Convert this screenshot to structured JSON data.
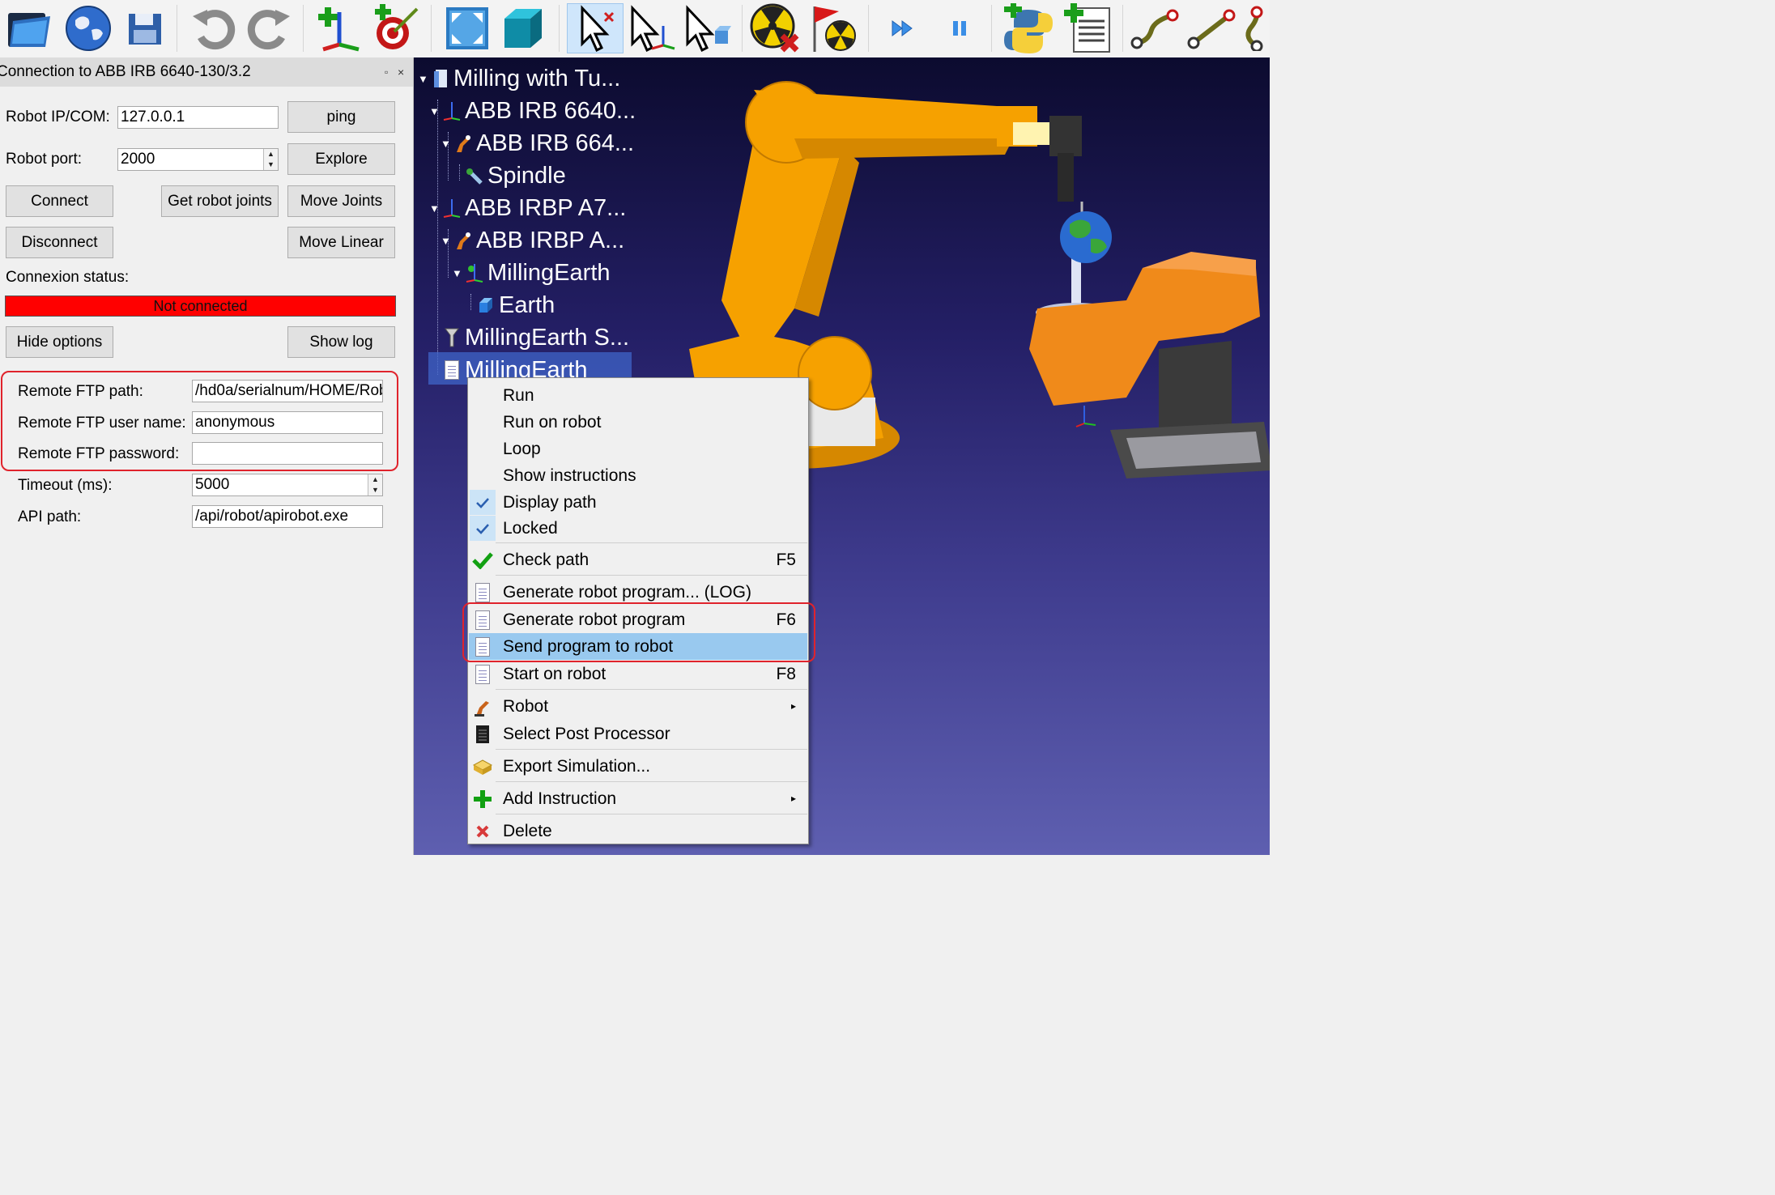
{
  "toolbar": {
    "buttons": [
      "open-icon",
      "globe-icon",
      "save-icon",
      "undo-icon",
      "redo-icon",
      "add-reference-frame-icon",
      "add-target-icon",
      "fit-all-icon",
      "box-view-icon",
      "select-icon",
      "move-reference-icon",
      "move-object-icon",
      "radiation-stop-icon",
      "radiation-flag-icon",
      "fast-forward-icon",
      "pause-icon",
      "python-icon",
      "add-program-icon",
      "path-icon-1",
      "path-icon-2",
      "path-icon-3"
    ]
  },
  "panel": {
    "title": "Connection to ABB IRB 6640-130/3.2",
    "float_btn": "▫",
    "close_btn": "×",
    "robot_ip_label": "Robot IP/COM:",
    "robot_ip_value": "127.0.0.1",
    "ping_label": "ping",
    "robot_port_label": "Robot port:",
    "robot_port_value": "2000",
    "explore_label": "Explore",
    "connect_label": "Connect",
    "get_joints_label": "Get robot joints",
    "move_joints_label": "Move Joints",
    "disconnect_label": "Disconnect",
    "move_linear_label": "Move Linear",
    "status_label": "Connexion status:",
    "status_value": "Not connected",
    "hide_options_label": "Hide options",
    "show_log_label": "Show log",
    "ftp_path_label": "Remote FTP path:",
    "ftp_path_value": "/hd0a/serialnum/HOME/Rob",
    "ftp_user_label": "Remote FTP user name:",
    "ftp_user_value": "anonymous",
    "ftp_password_label": "Remote FTP password:",
    "ftp_password_value": "",
    "timeout_label": "Timeout (ms):",
    "timeout_value": "5000",
    "api_path_label": "API path:",
    "api_path_value": "/api/robot/apirobot.exe"
  },
  "tree": {
    "items": [
      {
        "label": "Milling with Tu..."
      },
      {
        "label": "ABB IRB 6640..."
      },
      {
        "label": "ABB IRB 664..."
      },
      {
        "label": "Spindle"
      },
      {
        "label": "ABB IRBP A7..."
      },
      {
        "label": "ABB IRBP A..."
      },
      {
        "label": "MillingEarth"
      },
      {
        "label": "Earth"
      },
      {
        "label": "MillingEarth S..."
      },
      {
        "label": "MillingEarth"
      }
    ]
  },
  "context_menu": {
    "items": [
      {
        "label": "Run"
      },
      {
        "label": "Run on robot"
      },
      {
        "label": "Loop"
      },
      {
        "label": "Show instructions"
      },
      {
        "label": "Display path"
      },
      {
        "label": "Locked"
      },
      {
        "label": "Check path",
        "shortcut": "F5"
      },
      {
        "label": "Generate robot program... (LOG)"
      },
      {
        "label": "Generate robot program",
        "shortcut": "F6"
      },
      {
        "label": "Send program to robot"
      },
      {
        "label": "Start on robot",
        "shortcut": "F8"
      },
      {
        "label": "Robot"
      },
      {
        "label": "Select Post Processor"
      },
      {
        "label": "Export Simulation..."
      },
      {
        "label": "Add Instruction"
      },
      {
        "label": "Delete"
      }
    ]
  },
  "colors": {
    "status_red": "#ff0000",
    "highlight_box": "#e0232c",
    "robot_orange": "#f6a100",
    "positioner_orange": "#f08a1a",
    "menu_highlight": "#99c9ef"
  }
}
